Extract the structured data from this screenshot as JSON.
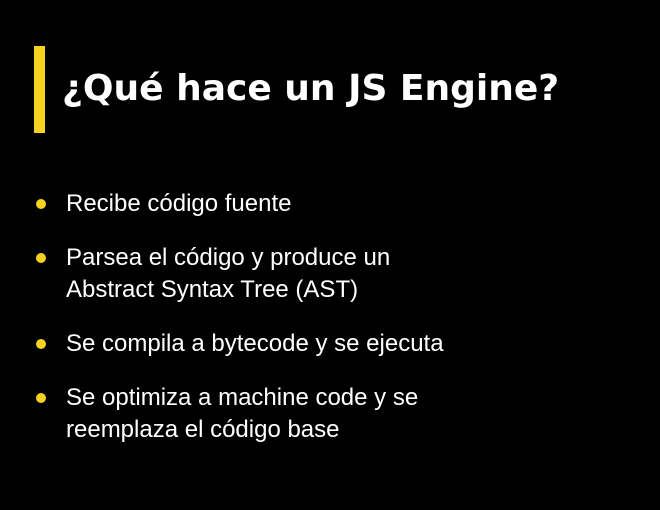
{
  "title": "¿Qué hace un JS Engine?",
  "colors": {
    "background": "#000000",
    "accent": "#F5D320",
    "text": "#FFFFFF"
  },
  "bullets": [
    {
      "text": "Recibe código fuente"
    },
    {
      "text": "Parsea el código y produce un\nAbstract Syntax Tree (AST)"
    },
    {
      "text": "Se compila a bytecode y se ejecuta"
    },
    {
      "text": "Se optimiza a machine code y se\nreemplaza el código base"
    }
  ]
}
